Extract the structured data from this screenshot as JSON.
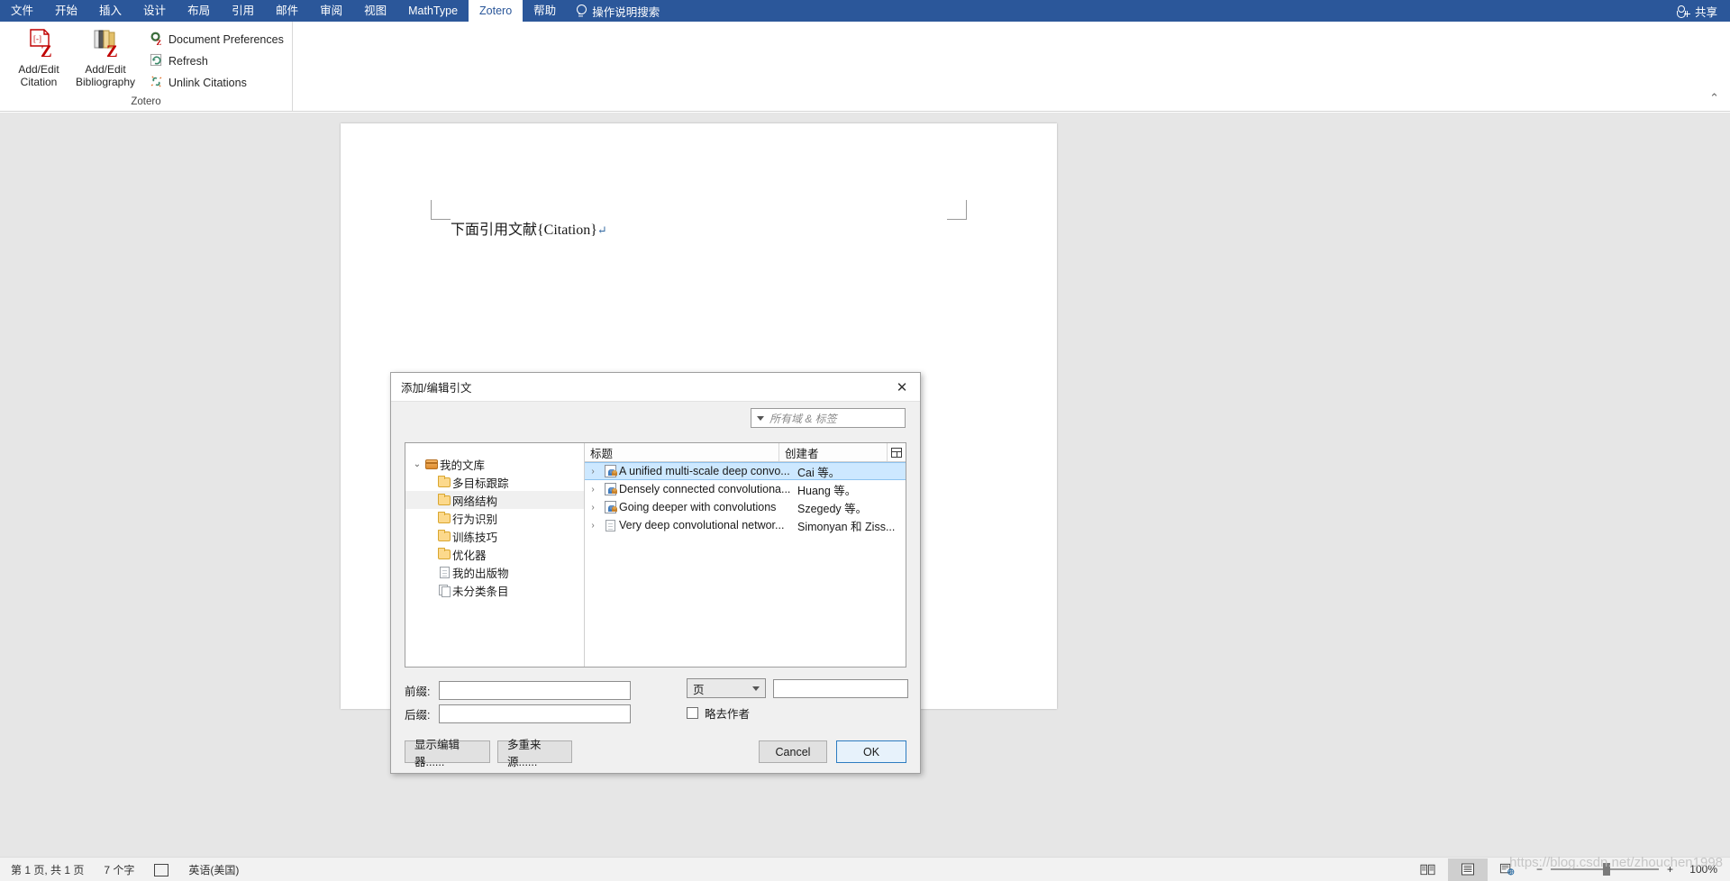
{
  "ribbon": {
    "tabs": [
      {
        "label": "文件",
        "active": false
      },
      {
        "label": "开始",
        "active": false
      },
      {
        "label": "插入",
        "active": false
      },
      {
        "label": "设计",
        "active": false
      },
      {
        "label": "布局",
        "active": false
      },
      {
        "label": "引用",
        "active": false
      },
      {
        "label": "邮件",
        "active": false
      },
      {
        "label": "审阅",
        "active": false
      },
      {
        "label": "视图",
        "active": false
      },
      {
        "label": "MathType",
        "active": false
      },
      {
        "label": "Zotero",
        "active": true
      },
      {
        "label": "帮助",
        "active": false
      }
    ],
    "tell_me": "操作说明搜索",
    "share_label": "共享",
    "group_label": "Zotero",
    "big_buttons": [
      {
        "line1": "Add/Edit",
        "line2": "Citation",
        "icon": "add-edit-citation-icon"
      },
      {
        "line1": "Add/Edit",
        "line2": "Bibliography",
        "icon": "add-edit-bibliography-icon"
      }
    ],
    "small_buttons": [
      {
        "label": "Document Preferences",
        "icon": "gear-z-icon"
      },
      {
        "label": "Refresh",
        "icon": "refresh-icon"
      },
      {
        "label": "Unlink Citations",
        "icon": "unlink-icon"
      }
    ],
    "collapse_glyph": "⌃"
  },
  "document": {
    "body_text": "下面引用文献{Citation}",
    "pilcrow": "↵"
  },
  "dialog": {
    "title": "添加/编辑引文",
    "close_glyph": "✕",
    "search": {
      "placeholder": "所有域 & 标签",
      "value": ""
    },
    "tree": [
      {
        "label": "我的文库",
        "icon": "library-icon",
        "level": 0,
        "twisty": "⌄",
        "shaded": false
      },
      {
        "label": "多目标跟踪",
        "icon": "folder-icon",
        "level": 1,
        "twisty": "",
        "shaded": false
      },
      {
        "label": "网络结构",
        "icon": "folder-icon",
        "level": 1,
        "twisty": "",
        "shaded": true
      },
      {
        "label": "行为识别",
        "icon": "folder-icon",
        "level": 1,
        "twisty": "",
        "shaded": false
      },
      {
        "label": "训练技巧",
        "icon": "folder-icon",
        "level": 1,
        "twisty": "",
        "shaded": false
      },
      {
        "label": "优化器",
        "icon": "folder-icon",
        "level": 1,
        "twisty": "",
        "shaded": false
      },
      {
        "label": "我的出版物",
        "icon": "document-icon",
        "level": 1,
        "twisty": "",
        "shaded": false
      },
      {
        "label": "未分类条目",
        "icon": "unfiled-icon",
        "level": 1,
        "twisty": "",
        "shaded": false
      }
    ],
    "items_columns": {
      "title": "标题",
      "creator": "创建者",
      "picker_icon": "column-picker-icon"
    },
    "items": [
      {
        "title": "A unified multi-scale deep convo...",
        "creator": "Cai 等。",
        "icon": "journal-article-icon",
        "twisty": "›",
        "selected": true
      },
      {
        "title": "Densely connected convolutiona...",
        "creator": "Huang 等。",
        "icon": "journal-article-icon",
        "twisty": "›",
        "selected": false
      },
      {
        "title": "Going deeper with convolutions",
        "creator": "Szegedy 等。",
        "icon": "journal-article-icon",
        "twisty": "›",
        "selected": false
      },
      {
        "title": "Very deep convolutional networ...",
        "creator": "Simonyan 和 Ziss...",
        "icon": "plain-document-icon",
        "twisty": "›",
        "selected": false
      }
    ],
    "form": {
      "prefix_label": "前缀:",
      "prefix_value": "",
      "suffix_label": "后缀:",
      "suffix_value": "",
      "locator_selected": "页",
      "locator_value": "",
      "suppress_author_label": "略去作者",
      "suppress_author_checked": false
    },
    "buttons": {
      "show_editor": "显示编辑器......",
      "multiple_sources": "多重来源......",
      "cancel": "Cancel",
      "ok": "OK"
    }
  },
  "statusbar": {
    "page_info": "第 1 页, 共 1 页",
    "word_count": "7 个字",
    "proofing_icon": "spell-check-icon",
    "language": "英语(美国)",
    "view_buttons": [
      {
        "name": "read-mode-icon",
        "active": false
      },
      {
        "name": "print-layout-icon",
        "active": true
      },
      {
        "name": "web-layout-icon",
        "active": false
      }
    ],
    "zoom_out": "−",
    "zoom_in": "+",
    "zoom_level": "100%",
    "watermark": "https://blog.csdn.net/zhouchen1998"
  },
  "colors": {
    "ribbon_blue": "#2b579a",
    "selection_blue": "#cde8ff",
    "accent_border": "#2d7cc1"
  }
}
